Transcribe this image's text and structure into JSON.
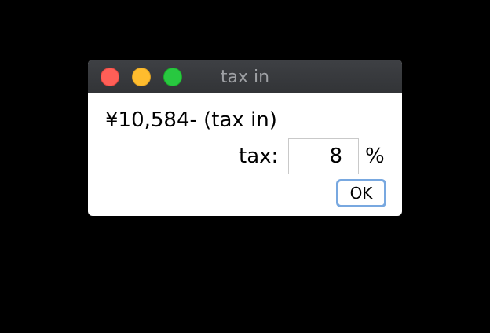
{
  "window": {
    "title": "tax in",
    "controls": [
      "close",
      "minimize",
      "zoom"
    ]
  },
  "content": {
    "price_text": "¥10,584- (tax in)",
    "tax_label": "tax:",
    "tax_value": "8",
    "percent_label": "%",
    "ok_label": "OK"
  },
  "colors": {
    "background": "#000000",
    "titlebar": "#3a3c40",
    "close": "#fe5f57",
    "minimize": "#febc2e",
    "zoom": "#28c840",
    "focus_ring": "#78a8e0"
  }
}
